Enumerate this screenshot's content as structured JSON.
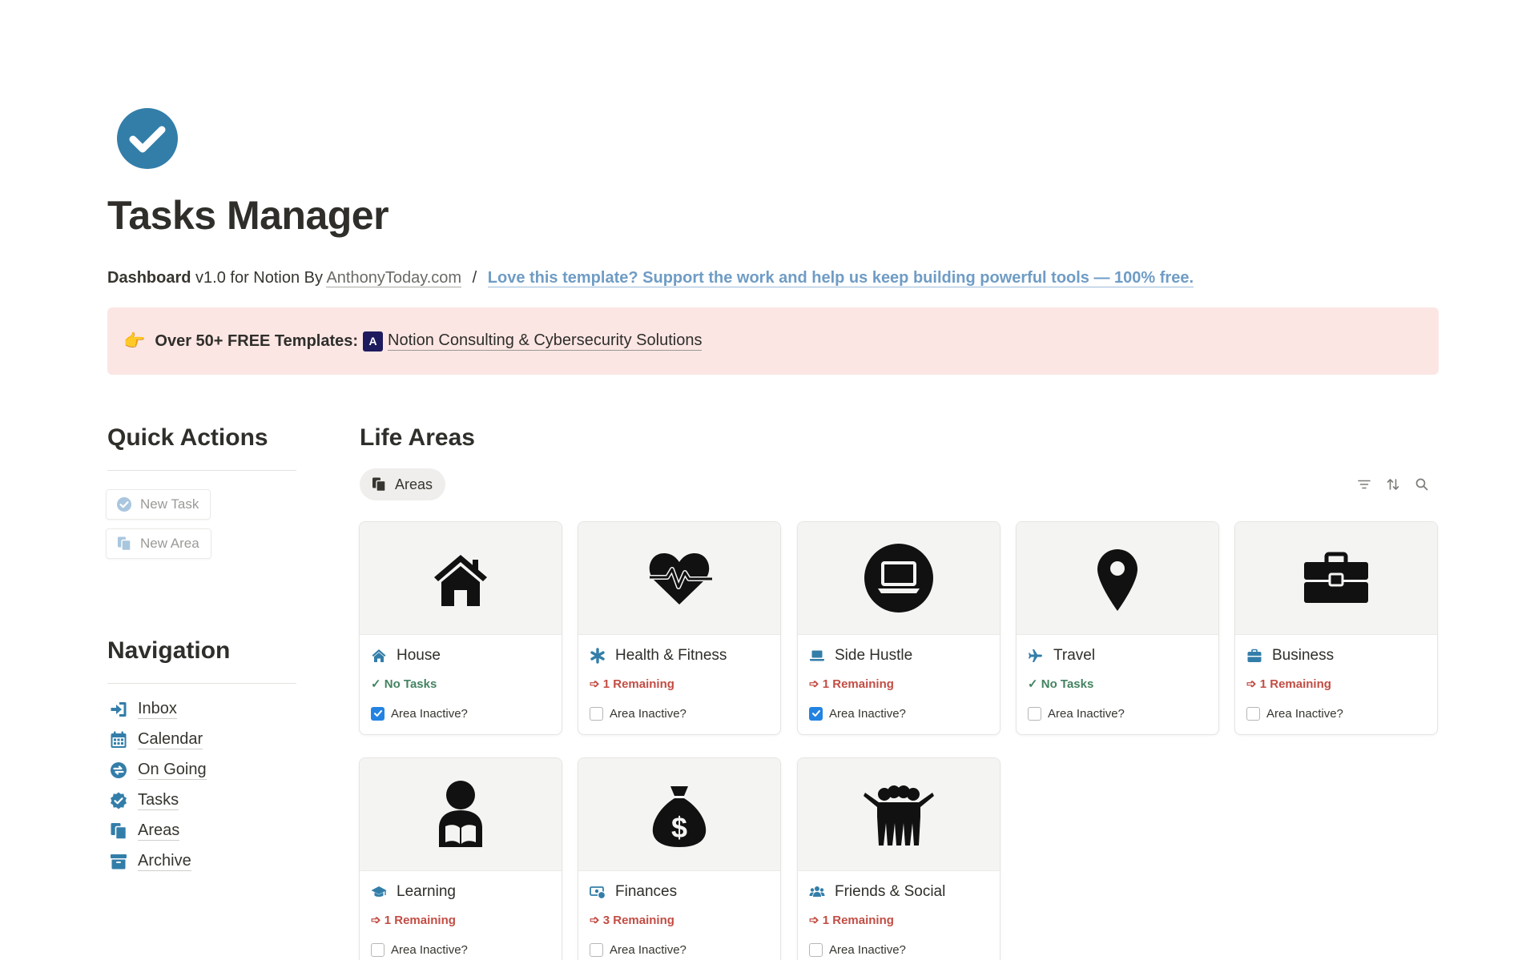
{
  "page": {
    "icon": "check-circle-icon",
    "title": "Tasks Manager"
  },
  "subtitle": {
    "bold": "Dashboard",
    "version_text": "v1.0 for Notion By",
    "site_link": "AnthonyToday.com",
    "separator": "/",
    "support_link": "Love this template? Support the work and help us keep building powerful tools — 100% free."
  },
  "callout": {
    "emoji": "👉",
    "strong": "Over 50+ FREE Templates:",
    "logo_text": "A",
    "link": "Notion Consulting & Cybersecurity Solutions"
  },
  "quick_actions": {
    "heading": "Quick Actions",
    "buttons": [
      {
        "label": "New Task",
        "icon": "check-badge-icon"
      },
      {
        "label": "New Area",
        "icon": "copy-icon"
      }
    ]
  },
  "navigation": {
    "heading": "Navigation",
    "items": [
      {
        "label": "Inbox",
        "icon": "sign-in-icon"
      },
      {
        "label": "Calendar",
        "icon": "calendar-icon"
      },
      {
        "label": "On Going",
        "icon": "ongoing-icon"
      },
      {
        "label": "Tasks",
        "icon": "check-badge-icon"
      },
      {
        "label": "Areas",
        "icon": "copy-icon"
      },
      {
        "label": "Archive",
        "icon": "archive-icon"
      }
    ]
  },
  "life_areas": {
    "heading": "Life Areas",
    "view_tab": "Areas",
    "toolbar": [
      "filter-icon",
      "sort-icon",
      "search-icon"
    ],
    "checkbox_label": "Area Inactive?",
    "cards": [
      {
        "name": "House",
        "icon": "house-icon",
        "status": "✓ No Tasks",
        "status_type": "green",
        "inactive": true
      },
      {
        "name": "Health & Fitness",
        "icon": "asterisk-icon",
        "status": "➩ 1 Remaining",
        "status_type": "red",
        "inactive": false
      },
      {
        "name": "Side Hustle",
        "icon": "laptop-icon",
        "status": "➩ 1 Remaining",
        "status_type": "red",
        "inactive": true
      },
      {
        "name": "Travel",
        "icon": "plane-icon",
        "status": "✓ No Tasks",
        "status_type": "green",
        "inactive": false
      },
      {
        "name": "Business",
        "icon": "briefcase-icon",
        "status": "➩ 1 Remaining",
        "status_type": "red",
        "inactive": false
      },
      {
        "name": "Learning",
        "icon": "graduation-cap-icon",
        "status": "➩ 1 Remaining",
        "status_type": "red",
        "inactive": false
      },
      {
        "name": "Finances",
        "icon": "money-icon",
        "status": "➩ 3 Remaining",
        "status_type": "red",
        "inactive": false
      },
      {
        "name": "Friends & Social",
        "icon": "users-icon",
        "status": "➩ 1 Remaining",
        "status_type": "red",
        "inactive": false
      }
    ]
  },
  "colors": {
    "icon_blue": "#337ea9",
    "callout_bg": "#fbe6e4",
    "status_red": "#c24d44",
    "status_green": "#448361",
    "checkbox_blue": "#2383e2"
  }
}
